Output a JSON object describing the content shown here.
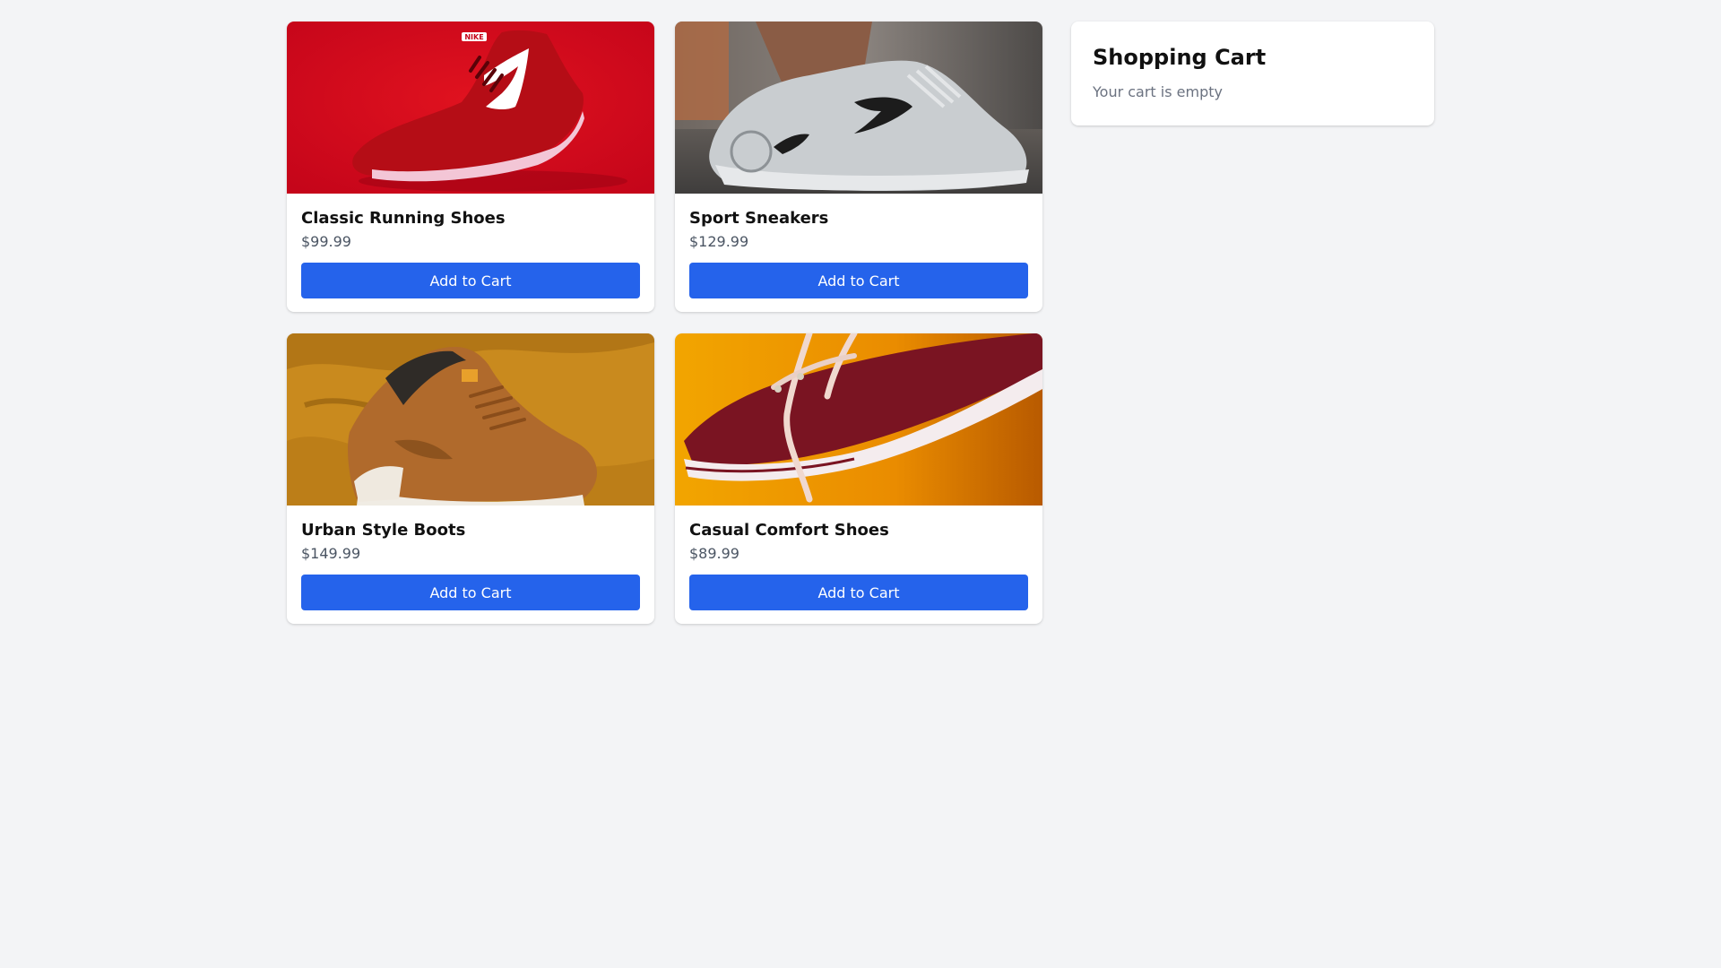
{
  "products": [
    {
      "name": "Classic Running Shoes",
      "price": "$99.99",
      "button_label": "Add to Cart",
      "image_icon": "red-running-shoe-image",
      "brand_text": "NIKE"
    },
    {
      "name": "Sport Sneakers",
      "price": "$129.99",
      "button_label": "Add to Cart",
      "image_icon": "grey-sneaker-image"
    },
    {
      "name": "Urban Style Boots",
      "price": "$149.99",
      "button_label": "Add to Cart",
      "image_icon": "tan-boot-image"
    },
    {
      "name": "Casual Comfort Shoes",
      "price": "$89.99",
      "button_label": "Add to Cart",
      "image_icon": "maroon-canvas-shoe-image"
    }
  ],
  "cart": {
    "title": "Shopping Cart",
    "empty_text": "Your cart is empty"
  },
  "colors": {
    "accent": "#2563eb",
    "background": "#f3f4f6"
  }
}
